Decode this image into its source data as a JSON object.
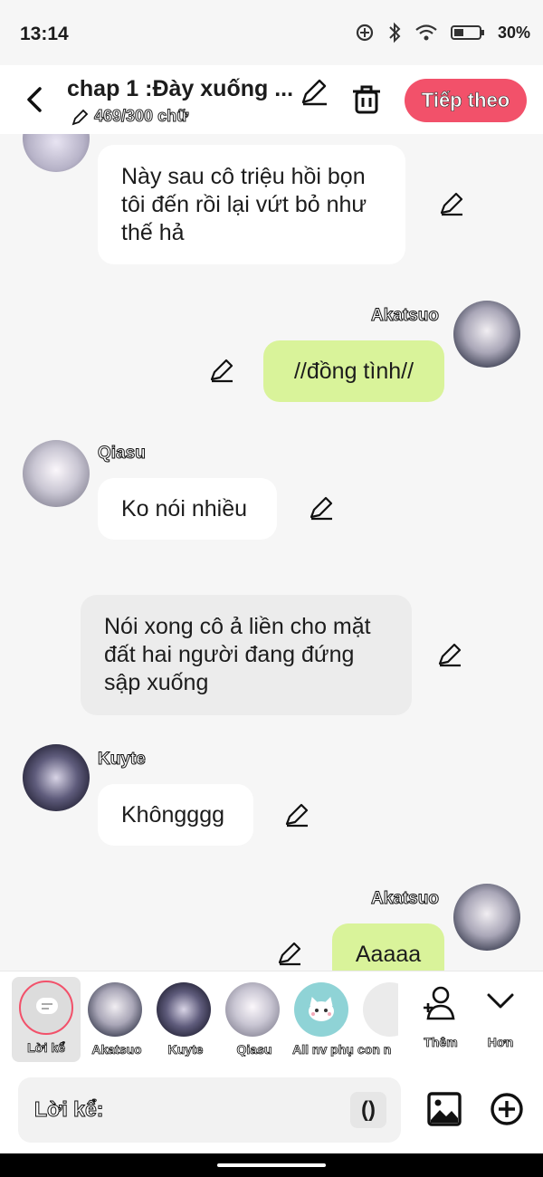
{
  "status_bar": {
    "time": "13:14",
    "battery": "30%"
  },
  "header": {
    "title": "chap 1 :Đày xuống ...",
    "word_counter": "469/300 chữ",
    "next_label": "Tiếp theo",
    "next_color": "#f2516a"
  },
  "messages": [
    {
      "side": "left",
      "speaker": "",
      "text": "Này sau cô triệu hồi bọn tôi đến rồi lại vứt bỏ như thế hả"
    },
    {
      "side": "right",
      "speaker": "Akatsuo",
      "text": "//đồng tình//"
    },
    {
      "side": "left",
      "speaker": "Qiasu",
      "text": "Ko nói nhiều"
    },
    {
      "side": "narration",
      "speaker": "",
      "text": "Nói xong cô ả liền cho mặt đất hai người đang đứng sập xuống"
    },
    {
      "side": "left",
      "speaker": "Kuyte",
      "text": "Khôngggg"
    },
    {
      "side": "right",
      "speaker": "Akatsuo",
      "text": "Aaaaa"
    }
  ],
  "characters": [
    {
      "label": "Lời kể",
      "selected": true
    },
    {
      "label": "Akatsuo"
    },
    {
      "label": "Kuyte"
    },
    {
      "label": "Qiasu"
    },
    {
      "label": "All nv phụ"
    },
    {
      "label": "con n"
    }
  ],
  "more_actions": {
    "add_label": "Thêm",
    "more_label": "Hơn"
  },
  "input": {
    "label": "Lời kể:",
    "paren_button": "()"
  },
  "colors": {
    "accent": "#f2516a",
    "bubble_green": "#d9f39a",
    "narration_bg": "#ececec"
  }
}
